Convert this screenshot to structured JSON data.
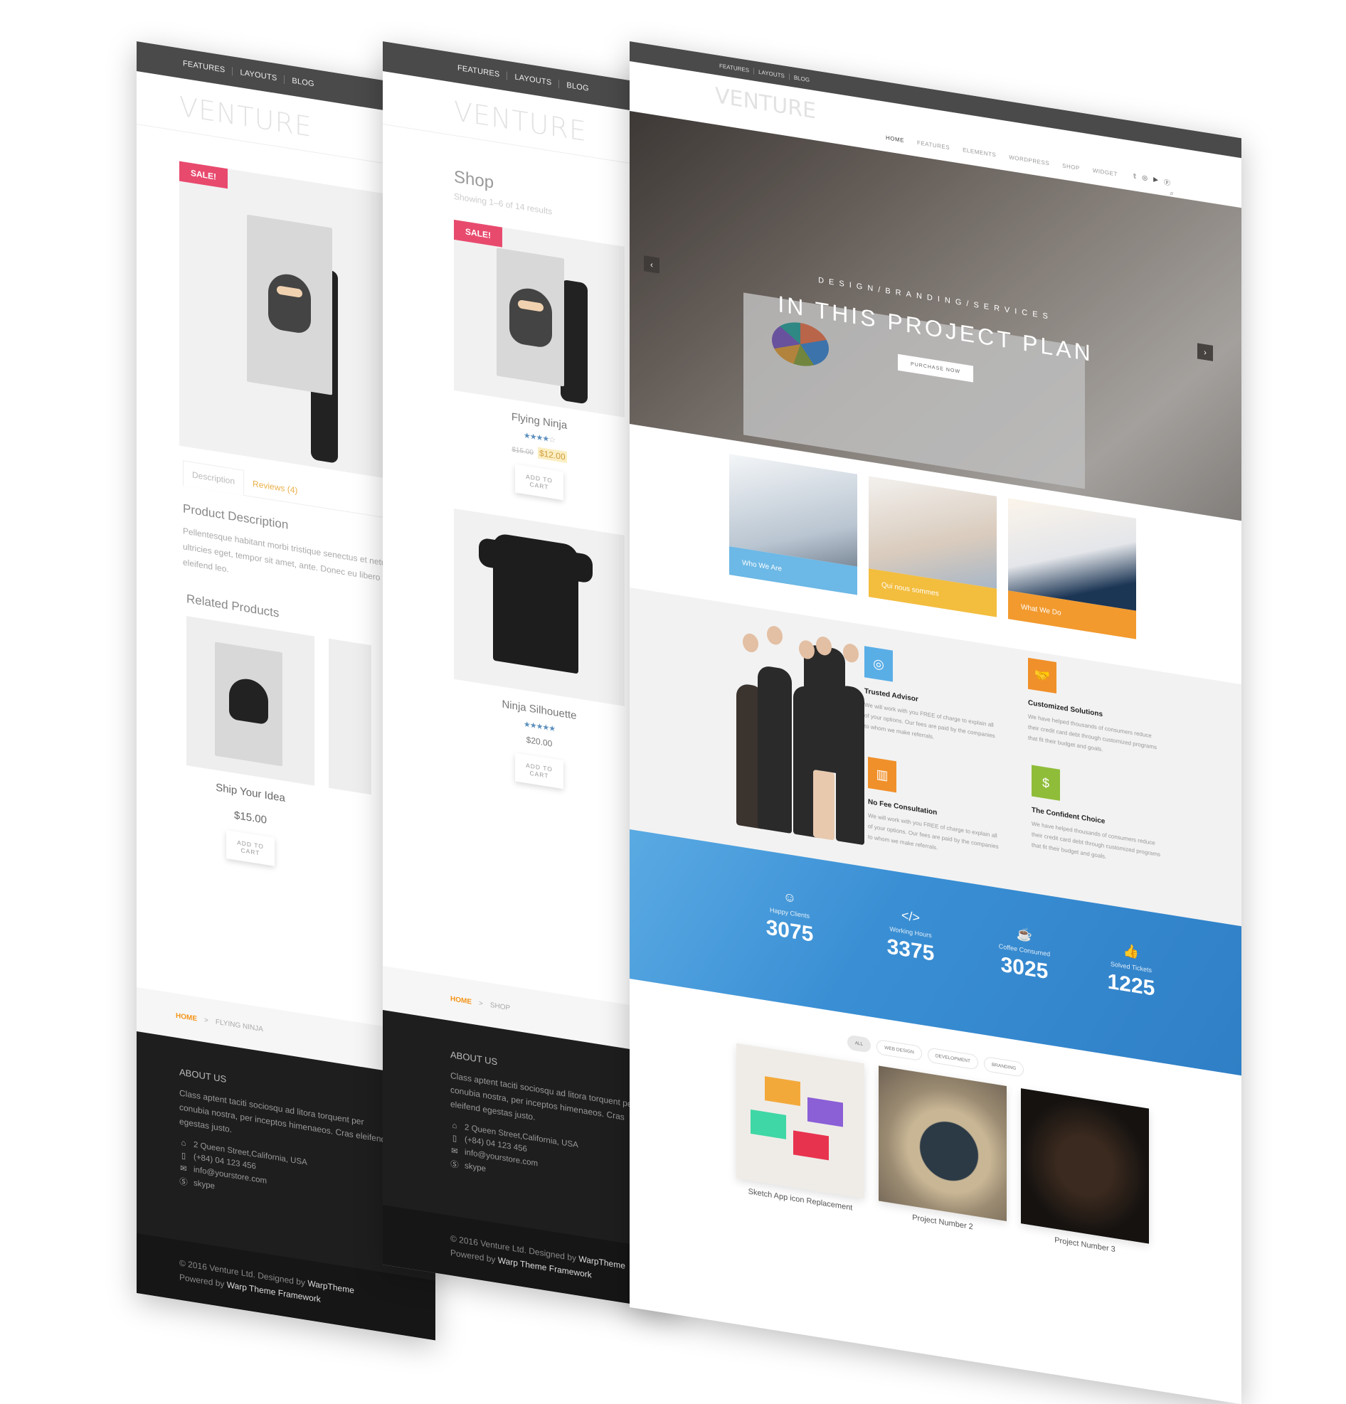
{
  "top_menu": [
    "FEATURES",
    "LAYOUTS",
    "BLOG"
  ],
  "logo": "VENTURE",
  "product_page": {
    "sale_badge": "SALE!",
    "tabs": [
      "Description",
      "Reviews (4)"
    ],
    "description_heading": "Product Description",
    "description_lines": [
      "Pellentesque habitant morbi tristique senectus et netus e",
      "ultricies eget, tempor sit amet, ante. Donec eu libero sit a",
      "eleifend leo."
    ],
    "related_heading": "Related Products",
    "related": [
      {
        "name": "Ship Your Idea",
        "price": "$15.00",
        "button": "ADD TO CART"
      }
    ],
    "breadcrumb": {
      "home": "HOME",
      "separator": ">",
      "current": "FLYING NINJA"
    }
  },
  "shop_page": {
    "title": "Shop",
    "result_count": "Showing 1–6 of 14 results",
    "products": [
      {
        "name": "Flying Ninja",
        "sale_badge": "SALE!",
        "rating": 4,
        "rating_max": 5,
        "old_price": "$15.00",
        "price": "$12.00",
        "button": "ADD TO CART"
      },
      {
        "name": "Ninja Silhouette",
        "rating": 5,
        "rating_max": 5,
        "price": "$20.00",
        "button": "ADD TO CART"
      }
    ],
    "breadcrumb": {
      "home": "HOME",
      "separator": ">",
      "current": "SHOP"
    }
  },
  "footer": {
    "about_heading": "ABOUT US",
    "about_text": "Class aptent taciti sociosqu ad litora torquent per conubia nostra, per inceptos himenaeos. Cras eleifend egestas justo.",
    "address": "2 Queen Street,California, USA",
    "phone": "(+84) 04 123 456",
    "email": "info@yourstore.com",
    "skype": "skype",
    "copyright_prefix": "© 2016 Venture Ltd. Designed by",
    "designer": "WarpTheme",
    "powered_prefix": "Powered by",
    "framework": "Warp Theme Framework"
  },
  "home_page": {
    "main_nav": [
      "HOME",
      "FEATURES",
      "ELEMENTS",
      "WORDPRESS",
      "SHOP",
      "WIDGET"
    ],
    "social_icons": [
      "twitter-icon",
      "instagram-icon",
      "youtube-icon",
      "pinterest-icon"
    ],
    "hero": {
      "eyebrow": "DESIGN/BRANDING/SERVICES",
      "title": "IN THIS PROJECT PLAN",
      "cta": "PURCHASE NOW",
      "prev": "‹",
      "next": "›"
    },
    "cards": [
      {
        "label": "Who We Are",
        "color": "#6cb8e6"
      },
      {
        "label": "Qui nous sommes",
        "color": "#f3bd3e"
      },
      {
        "label": "What We Do",
        "color": "#f29a2e"
      }
    ],
    "features": [
      {
        "title": "Trusted Advisor",
        "icon": "lifebuoy-icon",
        "glyph": "◎",
        "color": "#5aaee6",
        "text": "We will work with you FREE of charge to explain all of your options. Our fees are paid by the companies to whom we make referrals."
      },
      {
        "title": "Customized Solutions",
        "icon": "handshake-icon",
        "glyph": "🤝",
        "color": "#f0902a",
        "text": "We have helped thousands of consumers reduce their credit card debt through customized programs that fit their budget and goals."
      },
      {
        "title": "No Fee Consultation",
        "icon": "bar-chart-icon",
        "glyph": "▥",
        "color": "#f0902a",
        "text": "We will work with you FREE of charge to explain all of your options. Our fees are paid by the companies to whom we make referrals."
      },
      {
        "title": "The Confident Choice",
        "icon": "money-bag-icon",
        "glyph": "$",
        "color": "#8fbd3a",
        "text": "We have helped thousands of consumers reduce their credit card debt through customized programs that fit their budget and goals."
      }
    ],
    "stats": [
      {
        "label": "Happy Clients",
        "value": "3075",
        "icon": "smiley-icon",
        "glyph": "☺"
      },
      {
        "label": "Working Hours",
        "value": "3375",
        "icon": "code-icon",
        "glyph": "</>"
      },
      {
        "label": "Coffee Consumed",
        "value": "3025",
        "icon": "coffee-icon",
        "glyph": "☕"
      },
      {
        "label": "Solved Tickets",
        "value": "1225",
        "icon": "thumbs-up-icon",
        "glyph": "👍"
      }
    ],
    "filters": [
      "ALL",
      "WEB DESIGN",
      "DEVELOPMENT",
      "BRANDING"
    ],
    "portfolio": [
      {
        "name": "Sketch App icon Replacement"
      },
      {
        "name": "Project Number 2"
      },
      {
        "name": "Project Number 3"
      }
    ]
  },
  "colors": {
    "accent_orange": "#f39418",
    "sale_pink": "#e84a6e",
    "stats_blue": "#3a8fd4",
    "topbar": "#4a4a4a",
    "footer": "#1e1e1e"
  }
}
